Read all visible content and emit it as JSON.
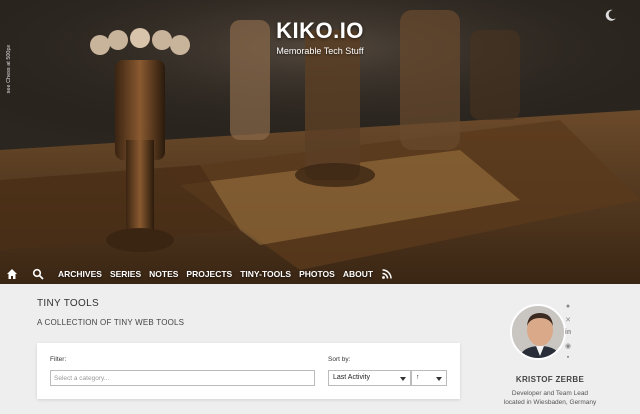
{
  "site": {
    "title": "KIKO.IO",
    "subtitle": "Memorable Tech Stuff",
    "photo_credit": "see Chess at 500px"
  },
  "nav": {
    "items": [
      "ARCHIVES",
      "SERIES",
      "NOTES",
      "PROJECTS",
      "TINY-TOOLS",
      "PHOTOS",
      "ABOUT"
    ],
    "icons": [
      "home-icon",
      "search-icon",
      "rss-icon"
    ]
  },
  "page": {
    "title": "TINY TOOLS",
    "subtitle": "A COLLECTION OF TINY WEB TOOLS"
  },
  "filter": {
    "filter_label": "Filter:",
    "filter_placeholder": "Select a category...",
    "sort_label": "Sort by:",
    "sort_value": "Last Activity",
    "direction_symbol": "↑"
  },
  "profile": {
    "name": "KRISTOF ZERBE",
    "role": "Developer and Team Lead",
    "location": "located in Wiesbaden, Germany",
    "social_icons": [
      "github-icon",
      "xing-icon",
      "linkedin-icon",
      "location-icon",
      "chat-icon"
    ]
  },
  "colors": {
    "background": "#eeeeee",
    "card": "#ffffff",
    "nav_text": "#ffffff"
  }
}
